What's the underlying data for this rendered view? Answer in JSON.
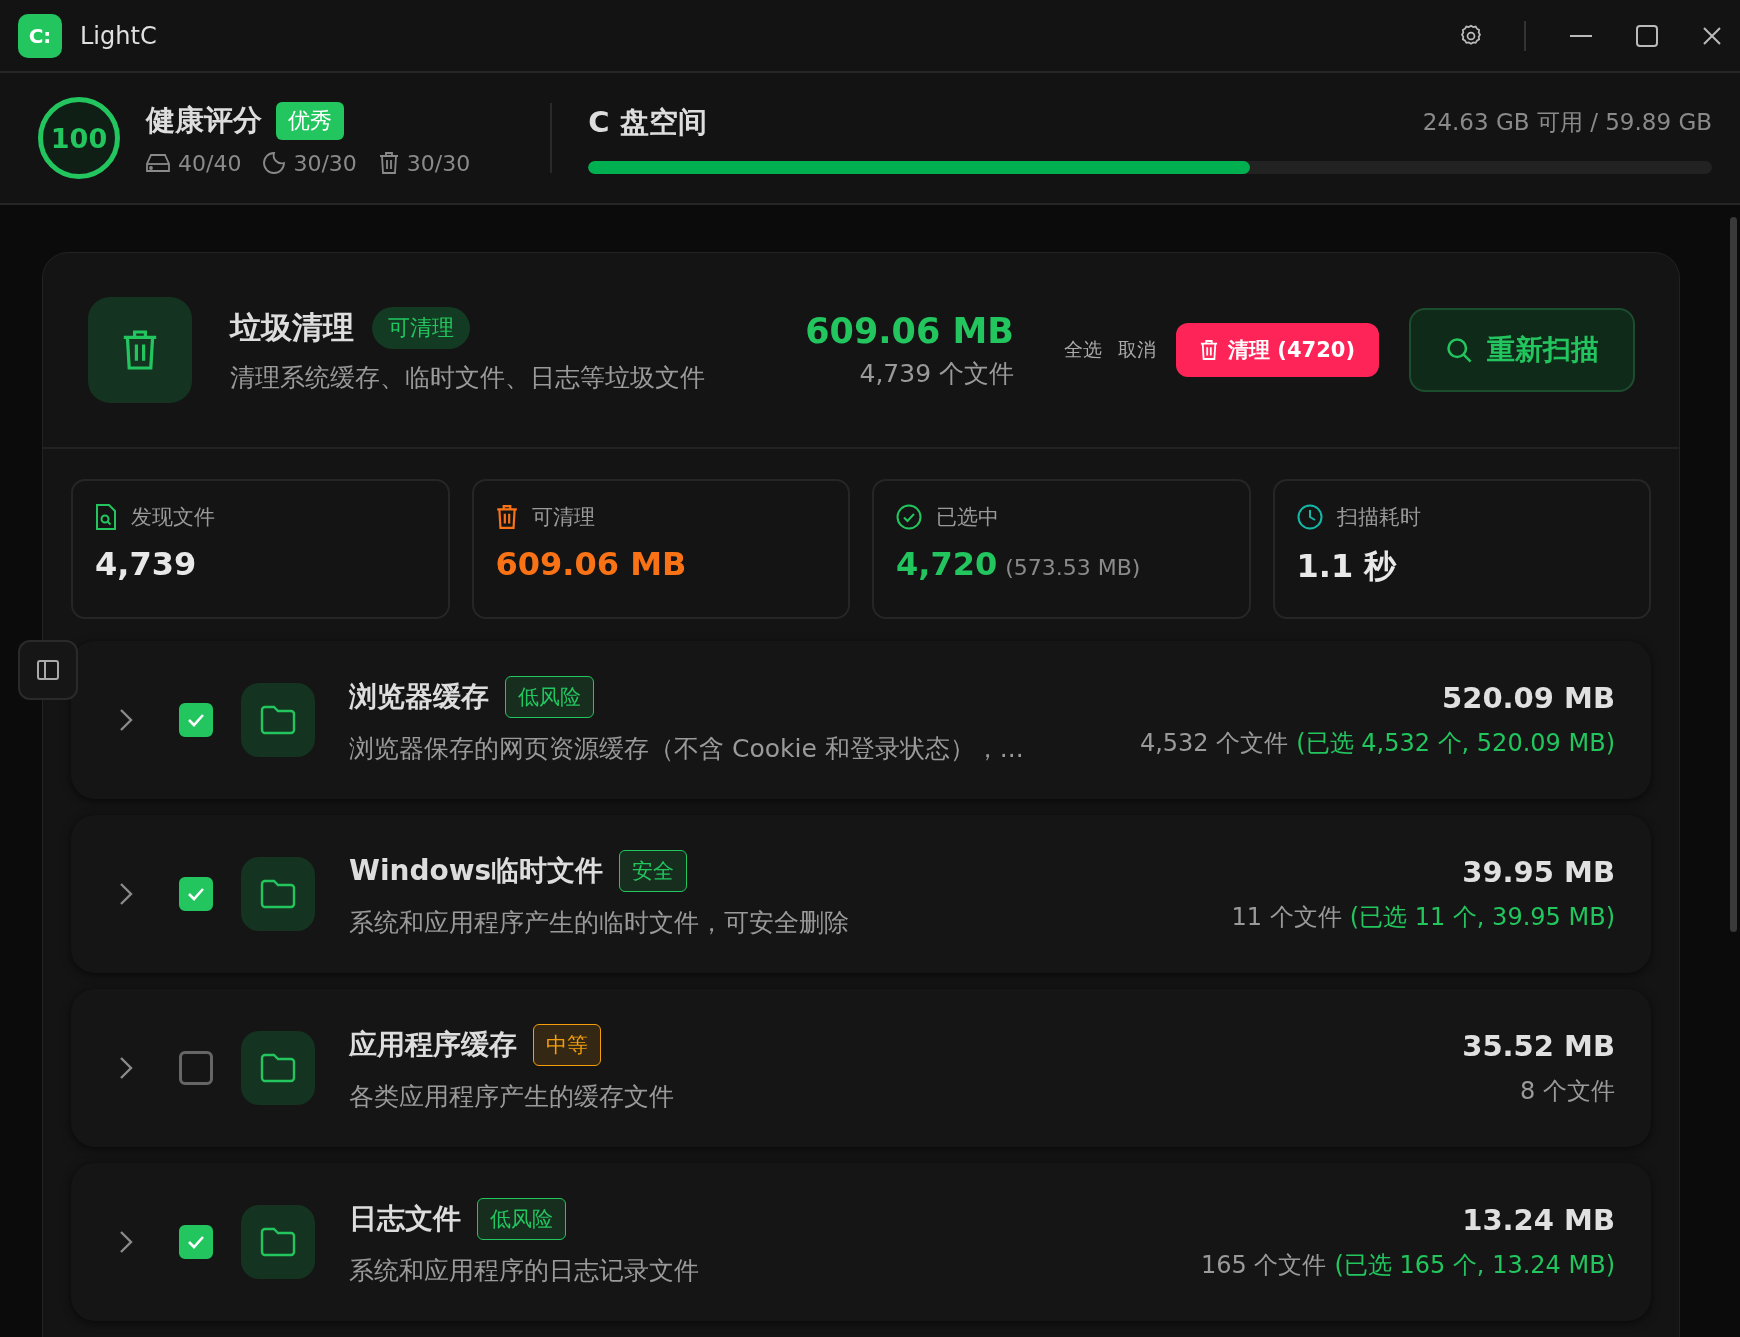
{
  "window": {
    "title": "LightC",
    "logo": "C:"
  },
  "health": {
    "score": "100",
    "title": "健康评分",
    "badge": "优秀",
    "metrics": [
      {
        "kind": "disk",
        "value": "40/40"
      },
      {
        "kind": "moon",
        "value": "30/30"
      },
      {
        "kind": "trash",
        "value": "30/30"
      }
    ]
  },
  "disk": {
    "title": "C 盘空间",
    "usage": "24.63 GB 可用 / 59.89 GB",
    "level": 0.589
  },
  "cleanup": {
    "title": "垃圾清理",
    "badge": "可清理",
    "description": "清理系统缓存、临时文件、日志等垃圾文件",
    "total_size": "609.06 MB",
    "total_files": "4,739 个文件",
    "select_all": "全选",
    "cancel": "取消",
    "clean_button": "清理 (4720)",
    "rescan_button": "重新扫描"
  },
  "stats": [
    {
      "kind": "found",
      "label": "发现文件",
      "value": "4,739"
    },
    {
      "kind": "cleanable",
      "label": "可清理",
      "value": "609.06 MB"
    },
    {
      "kind": "selected",
      "label": "已选中",
      "value": "4,720",
      "note": "(573.53 MB)"
    },
    {
      "kind": "time",
      "label": "扫描耗时",
      "value": "1.1 秒"
    }
  ],
  "categories": [
    {
      "name": "浏览器缓存",
      "risk": "低风险",
      "color": "#22c55e",
      "description": "浏览器保存的网页资源缓存（不含 Cookie 和登录状态），...",
      "size": "520.09 MB",
      "files": "4,532 个文件",
      "selected_info": "(已选 4,532 个, 520.09 MB)",
      "checked": true,
      "expanded": false
    },
    {
      "name": "Windows临时文件",
      "risk": "安全",
      "color": "#22c55e",
      "description": "系统和应用程序产生的临时文件，可安全删除",
      "size": "39.95 MB",
      "files": "11 个文件",
      "selected_info": "(已选 11 个, 39.95 MB)",
      "checked": true,
      "expanded": false
    },
    {
      "name": "应用程序缓存",
      "risk": "中等",
      "color": "#f59e0b",
      "description": "各类应用程序产生的缓存文件",
      "size": "35.52 MB",
      "files": "8 个文件",
      "checked": false,
      "expanded": false
    },
    {
      "name": "日志文件",
      "risk": "低风险",
      "color": "#22c55e",
      "description": "系统和应用程序的日志记录文件",
      "size": "13.24 MB",
      "files": "165 个文件",
      "selected_info": "(已选 165 个, 13.24 MB)",
      "checked": true,
      "expanded": false
    }
  ]
}
